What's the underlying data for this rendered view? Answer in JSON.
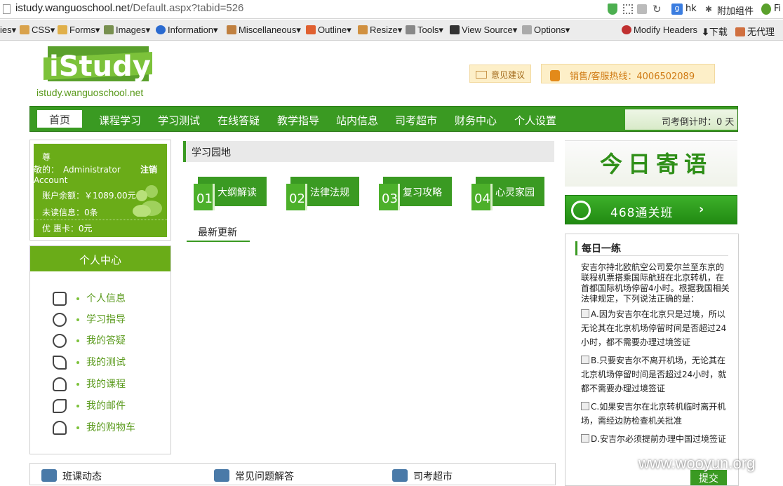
{
  "browser": {
    "url_domain": "istudy.wanguoschool.net",
    "url_path": "/Default.aspx?tabid=526",
    "profile": "hk",
    "addons": "附加组件",
    "fi": "Fi"
  },
  "toolbar": {
    "items": [
      "ies▾",
      "CSS▾",
      "Forms▾",
      "Images▾",
      "Information▾",
      "Miscellaneous▾",
      "Outline▾",
      "Resize▾",
      "Tools▾",
      "View Source▾",
      "Options▾",
      "Modify Headers",
      "下载",
      "无代理"
    ]
  },
  "site": {
    "logo_text": "iStudy",
    "logo_sub": "istudy.wanguoschool.net",
    "suggestion": "意见建议",
    "hotline": "销售/客服热线：4006502089"
  },
  "nav": {
    "items": [
      "首页",
      "课程学习",
      "学习测试",
      "在线答疑",
      "教学指导",
      "站内信息",
      "司考超市",
      "财务中心",
      "个人设置"
    ],
    "countdown": "司考倒计时：0 天"
  },
  "user": {
    "line1": "尊",
    "line2": "敬的：　Administrator",
    "logout": "注销",
    "line3": "Account",
    "balance": "账户余额：￥1089.00元",
    "unread": "未读信息：0条",
    "coupon": "优 惠卡：0元"
  },
  "personal": {
    "title": "个人中心",
    "items": [
      {
        "label": "个人信息",
        "icon": "clipboard-icon"
      },
      {
        "label": "学习指导",
        "icon": "users-icon"
      },
      {
        "label": "我的答疑",
        "icon": "chat-icon"
      },
      {
        "label": "我的测试",
        "icon": "pen-icon"
      },
      {
        "label": "我的课程",
        "icon": "bulb-icon"
      },
      {
        "label": "我的邮件",
        "icon": "wrench-icon"
      },
      {
        "label": "我的购物车",
        "icon": "person-icon"
      }
    ]
  },
  "study": {
    "title": "学习园地",
    "cards": [
      {
        "num": "01",
        "label": "大纲解读"
      },
      {
        "num": "02",
        "label": "法律法规"
      },
      {
        "num": "03",
        "label": "复习攻略"
      },
      {
        "num": "04",
        "label": "心灵家园"
      }
    ],
    "latest": "最新更新"
  },
  "right": {
    "today": "今日寄语",
    "pass": "468通关班",
    "daily_title": "每日一练",
    "question": "安吉尔持北欧航空公司爱尔兰至东京的联程机票搭乘国际航班在北京转机，在首都国际机场停留4小时。根据我国相关法律规定，下列说法正确的是：",
    "options": [
      "A.因为安吉尔在北京只是过境，所以无论其在北京机场停留时间是否超过24小时，都不需要办理过境签证",
      "B.只要安吉尔不离开机场，无论其在北京机场停留时间是否超过24小时，就都不需要办理过境签证",
      "C.如果安吉尔在北京转机临时离开机场，需经边防检查机关批准",
      "D.安吉尔必须提前办理中国过境签证"
    ],
    "submit": "提交"
  },
  "bottom": {
    "items": [
      "班课动态",
      "常见问题解答",
      "司考超市"
    ]
  },
  "watermark": "www.wooyun.org",
  "colors": {
    "primary": "#3a9a22",
    "secondary": "#6aac18"
  }
}
